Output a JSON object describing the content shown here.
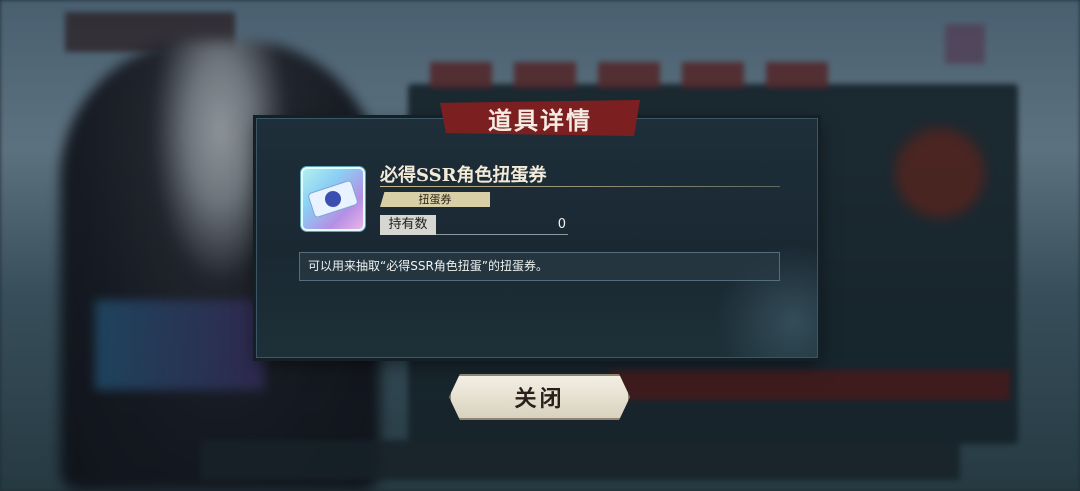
{
  "dialog": {
    "title": "道具详情",
    "item": {
      "name": "必得SSR角色扭蛋券",
      "category_tag": "扭蛋券",
      "hold_label": "持有数",
      "hold_value": "0",
      "icon": "gacha-ticket-icon"
    },
    "description": "可以用来抽取“必得SSR角色扭蛋”的扭蛋券。",
    "close_label": "关闭"
  },
  "colors": {
    "banner": "#7c1f21",
    "panel": "#1e2f3a",
    "tag": "#d9cfa7",
    "button": "#f3efe3"
  }
}
